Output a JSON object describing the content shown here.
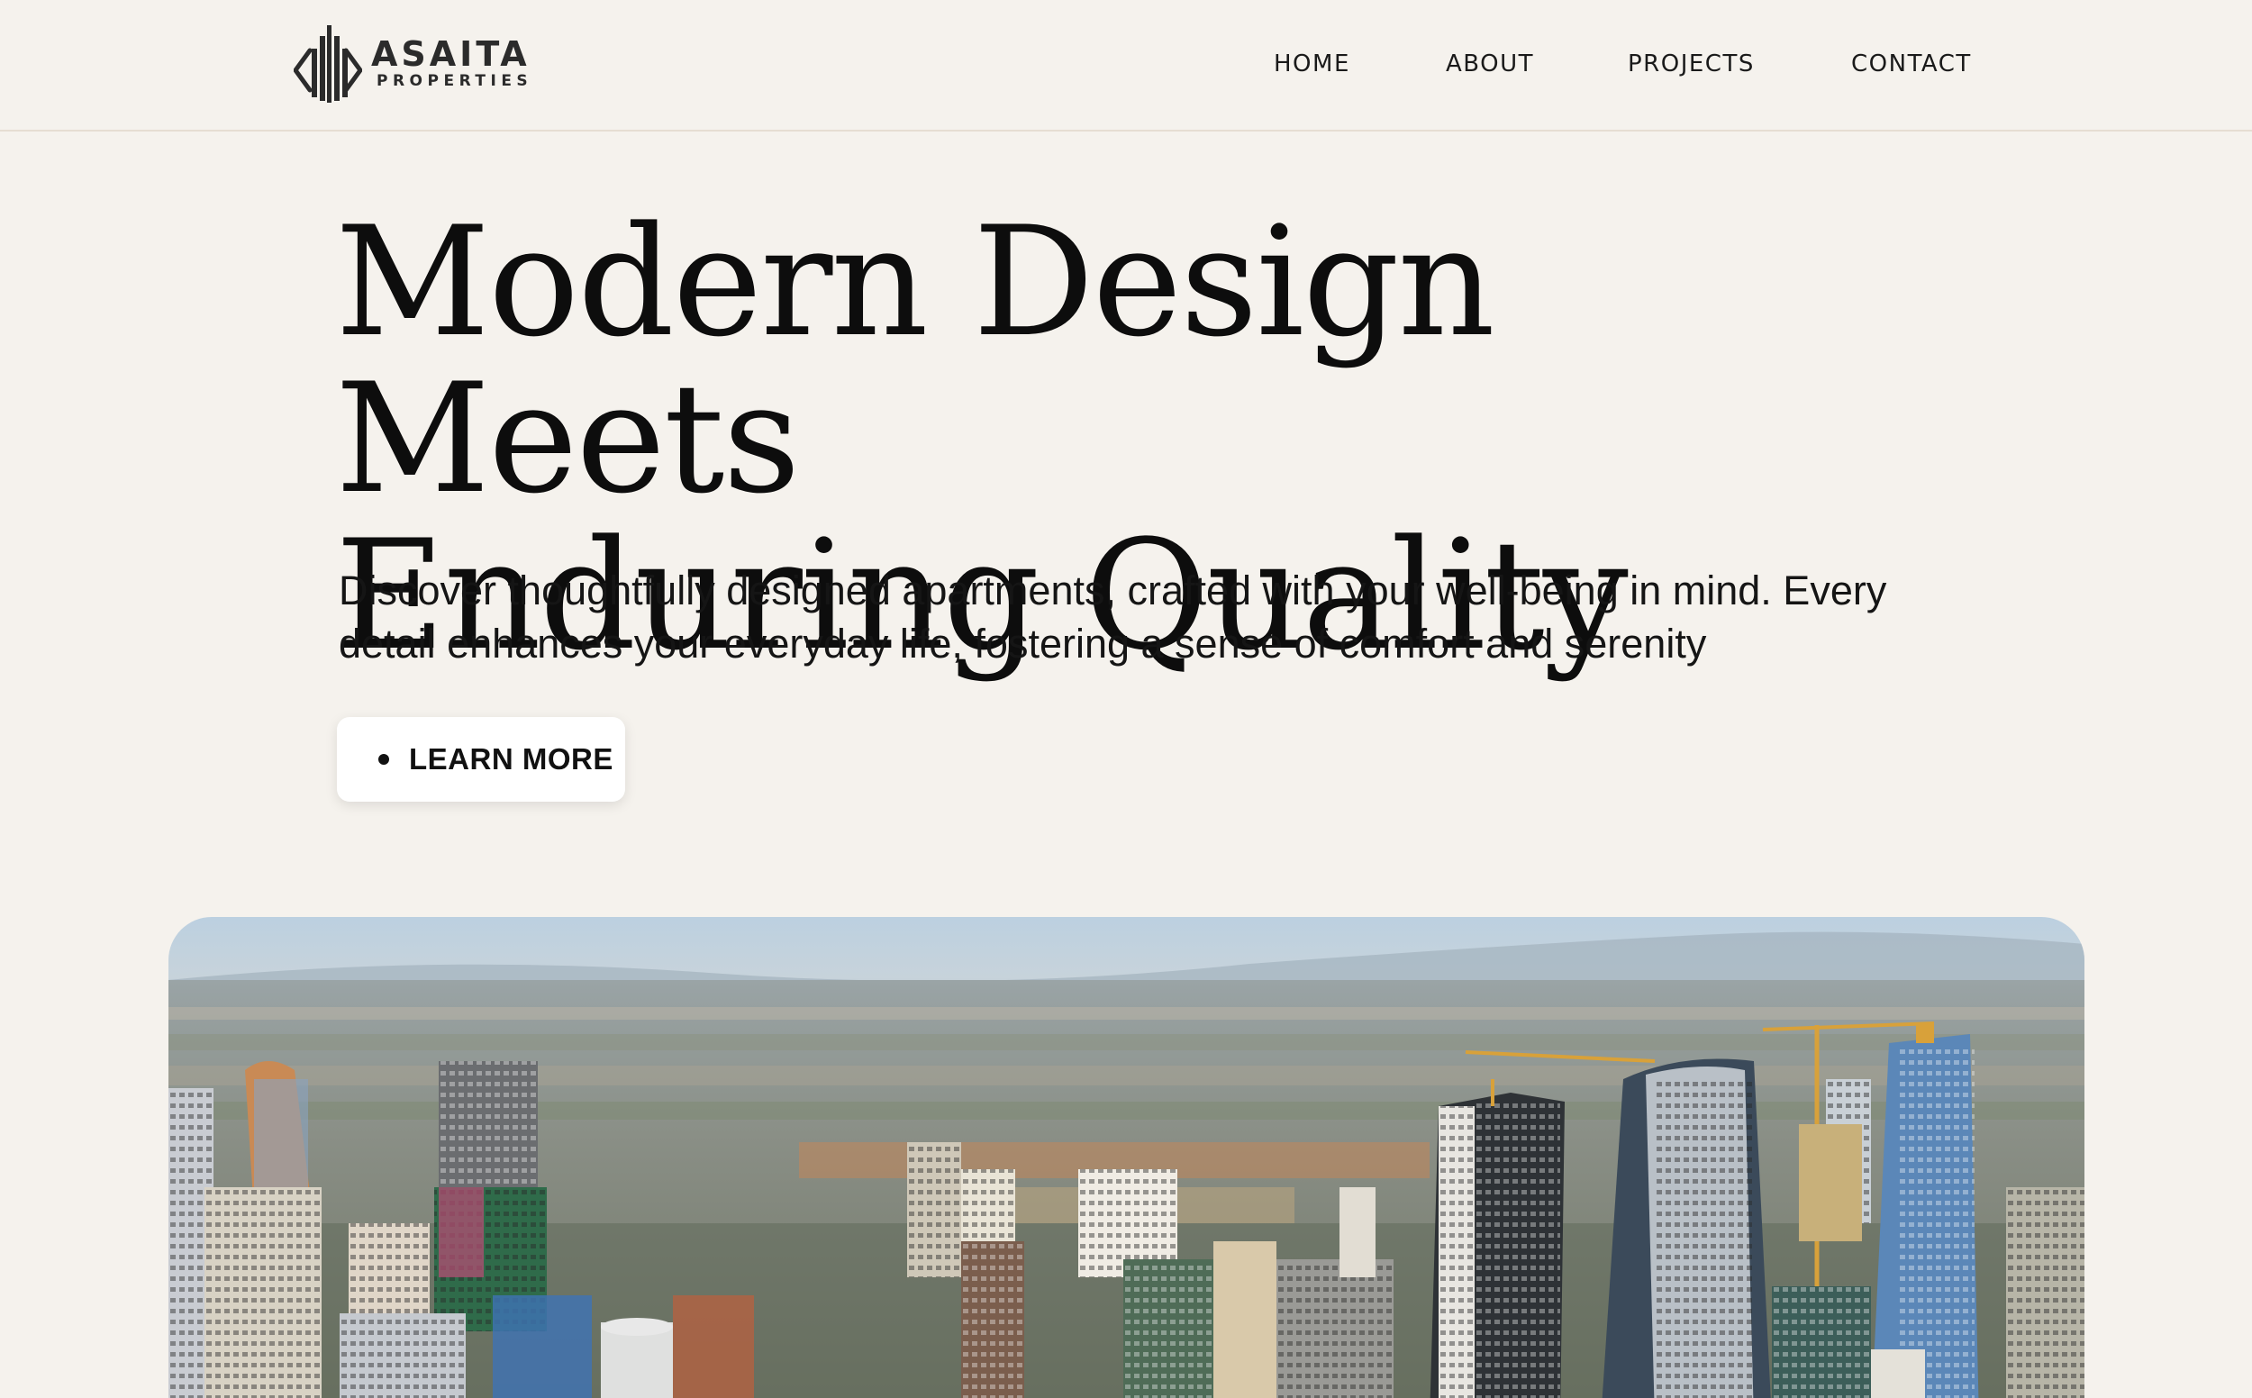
{
  "header": {
    "logo": {
      "name": "ASAITA",
      "sub": "PROPERTIES"
    },
    "nav": [
      {
        "label": "HOME"
      },
      {
        "label": "ABOUT"
      },
      {
        "label": "PROJECTS"
      },
      {
        "label": "CONTACT"
      }
    ]
  },
  "hero": {
    "title_line1": "Modern Design Meets",
    "title_line2": "Enduring Quality",
    "description": "Discover thoughtfully designed apartments, crafted with your well-being in mind. Every detail enhances your everyday life, fostering a sense of comfort and serenity",
    "cta_label": "LEARN MORE"
  },
  "colors": {
    "background": "#f5f2ed",
    "text": "#111111",
    "button_bg": "#ffffff",
    "divider": "#e6ddd2"
  }
}
